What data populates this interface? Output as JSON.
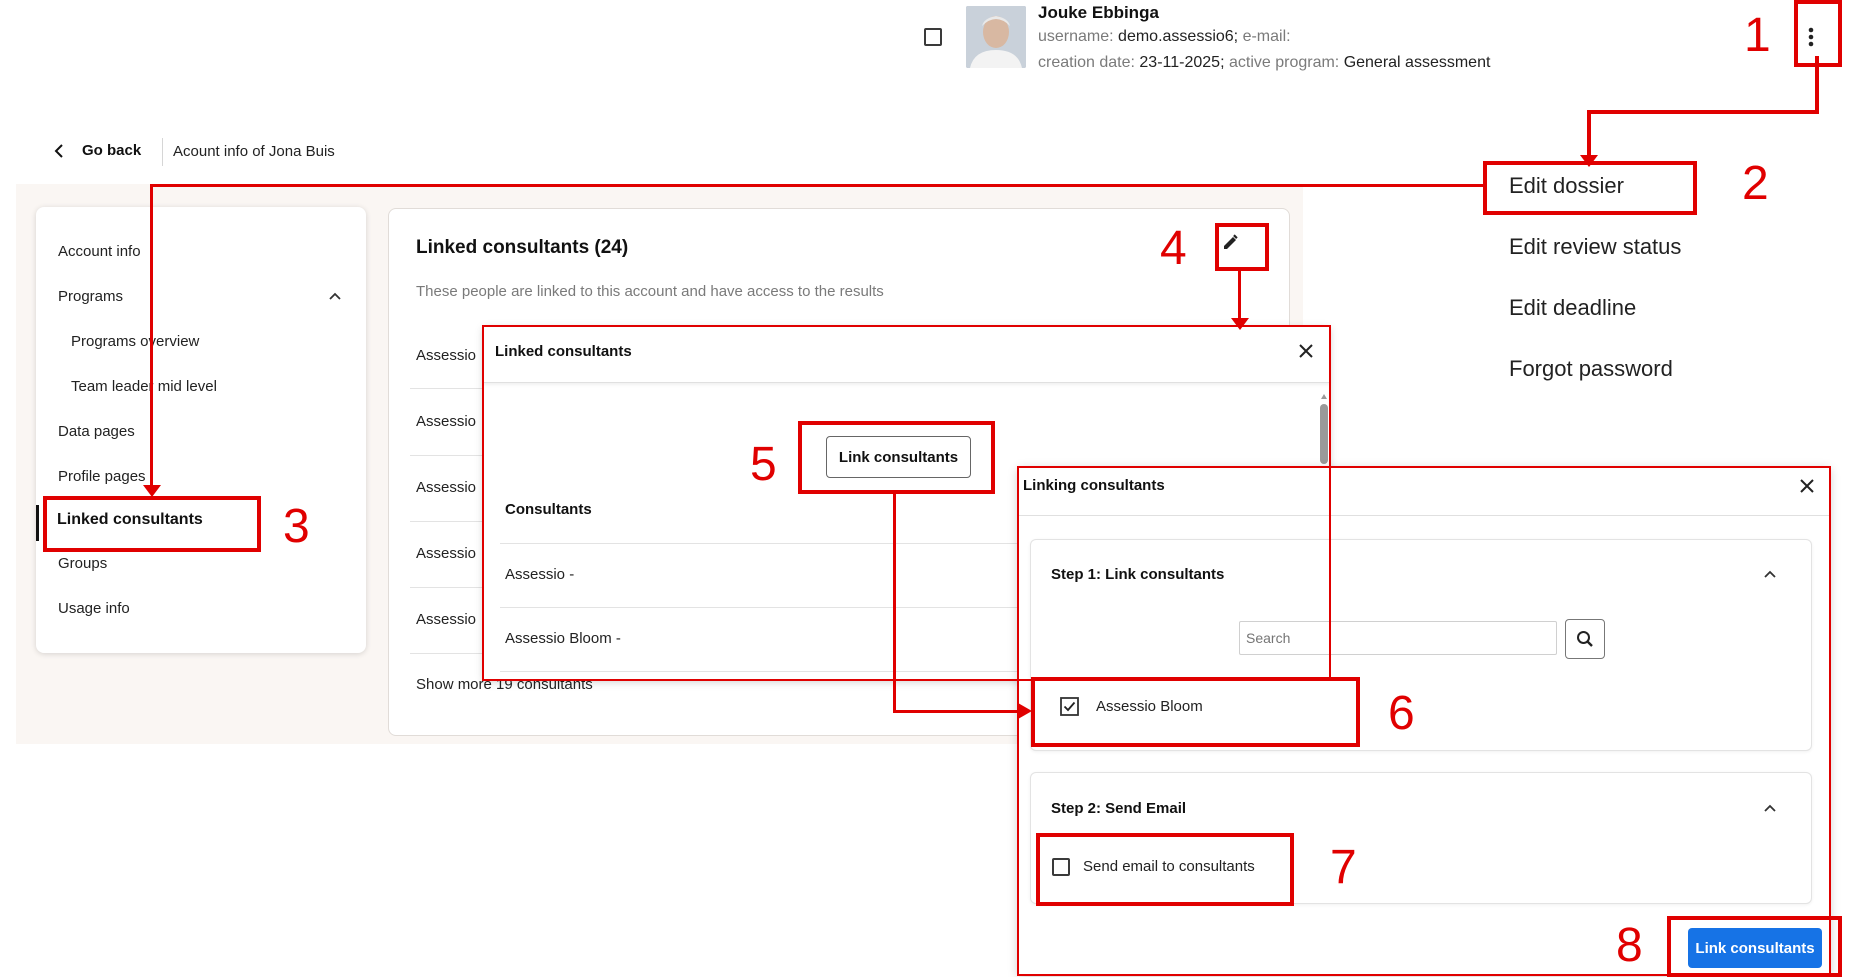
{
  "user": {
    "name": "Jouke Ebbinga",
    "username_label": "username:",
    "username": "demo.assessio6;",
    "email_label": "e-mail:",
    "creation_label": "creation date:",
    "creation_date": "23-11-2025;",
    "program_label": "active program:",
    "program": "General assessment"
  },
  "topbar": {
    "go_back": "Go back",
    "title": "Acount info of Jona Buis"
  },
  "sidebar": {
    "items": [
      {
        "label": "Account info"
      },
      {
        "label": "Programs"
      },
      {
        "label": "Programs overview"
      },
      {
        "label": "Team leader mid level"
      },
      {
        "label": "Data pages"
      },
      {
        "label": "Profile pages"
      },
      {
        "label": "Linked consultants"
      },
      {
        "label": "Groups"
      },
      {
        "label": "Usage info"
      }
    ]
  },
  "card": {
    "title": "Linked consultants (24)",
    "subtitle": "These people are linked to this account and have access to the results",
    "rows": [
      "Assessio",
      "Assessio",
      "Assessio",
      "Assessio",
      "Assessio"
    ],
    "show_more": "Show more 19 consultants"
  },
  "menu": {
    "items": [
      "Edit dossier",
      "Edit review status",
      "Edit deadline",
      "Forgot password"
    ]
  },
  "modal1": {
    "title": "Linked consultants",
    "button": "Link consultants",
    "column_header": "Consultants",
    "rows": [
      "Assessio -",
      "Assessio Bloom -"
    ]
  },
  "modal2": {
    "title": "Linking consultants",
    "step1_title": "Step 1: Link consultants",
    "search_placeholder": "Search",
    "option_label": "Assessio Bloom",
    "option_checked": true,
    "step2_title": "Step 2: Send Email",
    "email_label": "Send email to consultants",
    "email_checked": false,
    "primary_button": "Link consultants"
  },
  "annotations": [
    "1",
    "2",
    "3",
    "4",
    "5",
    "6",
    "7",
    "8"
  ],
  "colors": {
    "annotation": "#e00000",
    "primary": "#1673e6",
    "page_bg": "#faf6f3"
  },
  "icons": [
    "kebab-menu-icon",
    "chevron-left-icon",
    "chevron-up-icon",
    "pencil-icon",
    "close-icon",
    "search-icon",
    "checkbox-checked-icon"
  ]
}
